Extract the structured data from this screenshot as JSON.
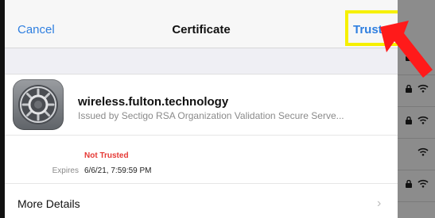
{
  "navbar": {
    "cancel_label": "Cancel",
    "title": "Certificate",
    "trust_label": "Trust"
  },
  "certificate": {
    "name": "wireless.fulton.technology",
    "issuer": "Issued by Sectigo RSA Organization Validation Secure Serve..."
  },
  "status": {
    "trust_status": "Not Trusted",
    "expires_label": "Expires",
    "expires_value": "6/6/21, 7:59:59 PM"
  },
  "details": {
    "label": "More Details"
  },
  "icons": {
    "certificate": "gear-settings-icon",
    "chevron": "chevron-right-icon",
    "wifi": "wifi-icon",
    "lock": "lock-icon",
    "annotation": "red-arrow"
  },
  "colors": {
    "link_blue": "#2f7fe0",
    "highlight_yellow": "#f6f000",
    "not_trusted_red": "#e53935",
    "arrow_red": "#ff1a1a"
  }
}
